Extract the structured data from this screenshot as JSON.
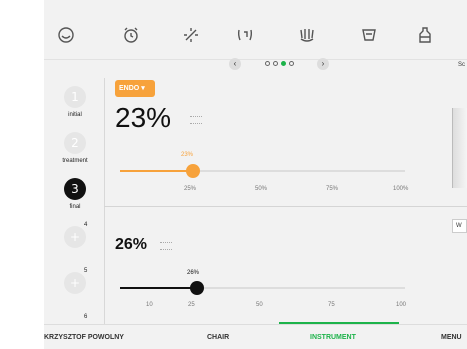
{
  "topbar": {
    "icons": [
      "tooth-smile-icon",
      "alarm-clock-icon",
      "sun-sparkle-icon",
      "bracket-tooth-icon",
      "crown-tooth-icon",
      "cup-tooth-icon",
      "bottle-icon"
    ]
  },
  "steps": [
    {
      "number": "1",
      "label": "initial",
      "active": false
    },
    {
      "number": "2",
      "label": "treatment",
      "active": false
    },
    {
      "number": "3",
      "label": "final",
      "active": true
    },
    {
      "number": "+",
      "sup": "4"
    },
    {
      "number": "+",
      "sup": "5"
    },
    {
      "sup": "6"
    }
  ],
  "pager": {
    "prev": "‹",
    "next": "›",
    "dots": 4,
    "active_index": 2
  },
  "panel1": {
    "badge": "ENDO",
    "badge_arrow": "▾",
    "value": "23%",
    "slider_value": "23%",
    "level": 23,
    "ticks": [
      "25%",
      "50%",
      "75%",
      "100%"
    ]
  },
  "panel2": {
    "value": "26%",
    "slider_value": "26%",
    "level": 26,
    "ticks": [
      "10",
      "25",
      "50",
      "75",
      "100"
    ]
  },
  "right": {
    "label_top": "Sc",
    "btn": "W"
  },
  "bottom": {
    "user": "KRZYSZTOF POWOLNY",
    "chair": "CHAIR",
    "instrument": "INSTRUMENT",
    "menu": "MENU"
  },
  "colors": {
    "accent": "#f7a23b",
    "active": "#1db34a",
    "dark": "#111111"
  }
}
